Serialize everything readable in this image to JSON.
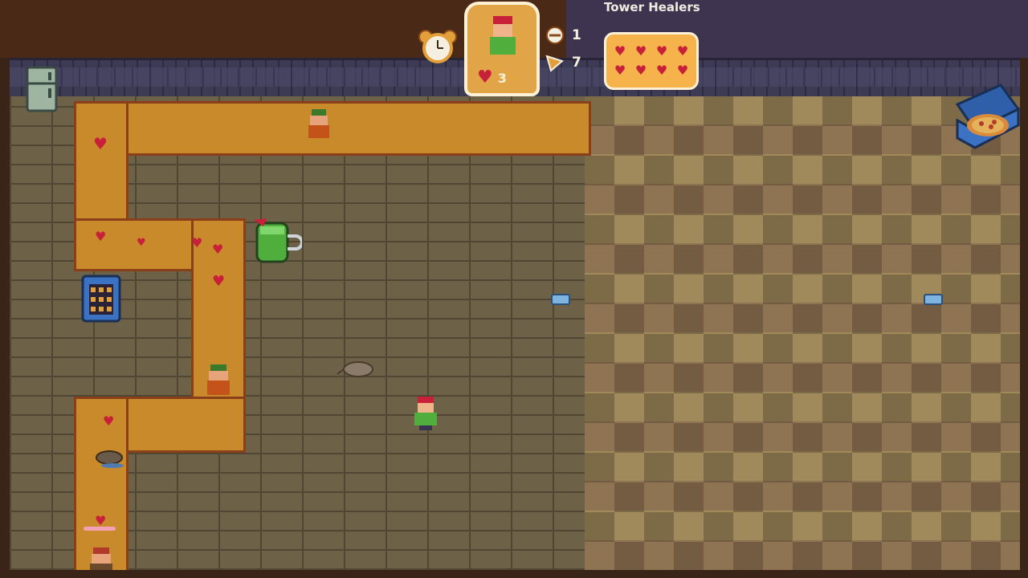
{
  "hud": {
    "tower_title": "Tower Healers",
    "player_hp": "3",
    "resources": [
      {
        "name": "pizza-slice-count",
        "value": "1"
      },
      {
        "name": "cheese-count",
        "value": "7"
      }
    ],
    "tower_card_hearts": 8
  },
  "colors": {
    "path": "#c98a2c",
    "path_border": "#8a3f18",
    "heart": "#c9203a",
    "card": "#f6b34c",
    "hud_text": "#f4efe0"
  },
  "icons": [
    "alarm-clock-icon",
    "pizza-slice-icon",
    "cheese-icon",
    "heart-icon",
    "pizza-box-icon",
    "fridge-icon",
    "health-potion-icon"
  ]
}
